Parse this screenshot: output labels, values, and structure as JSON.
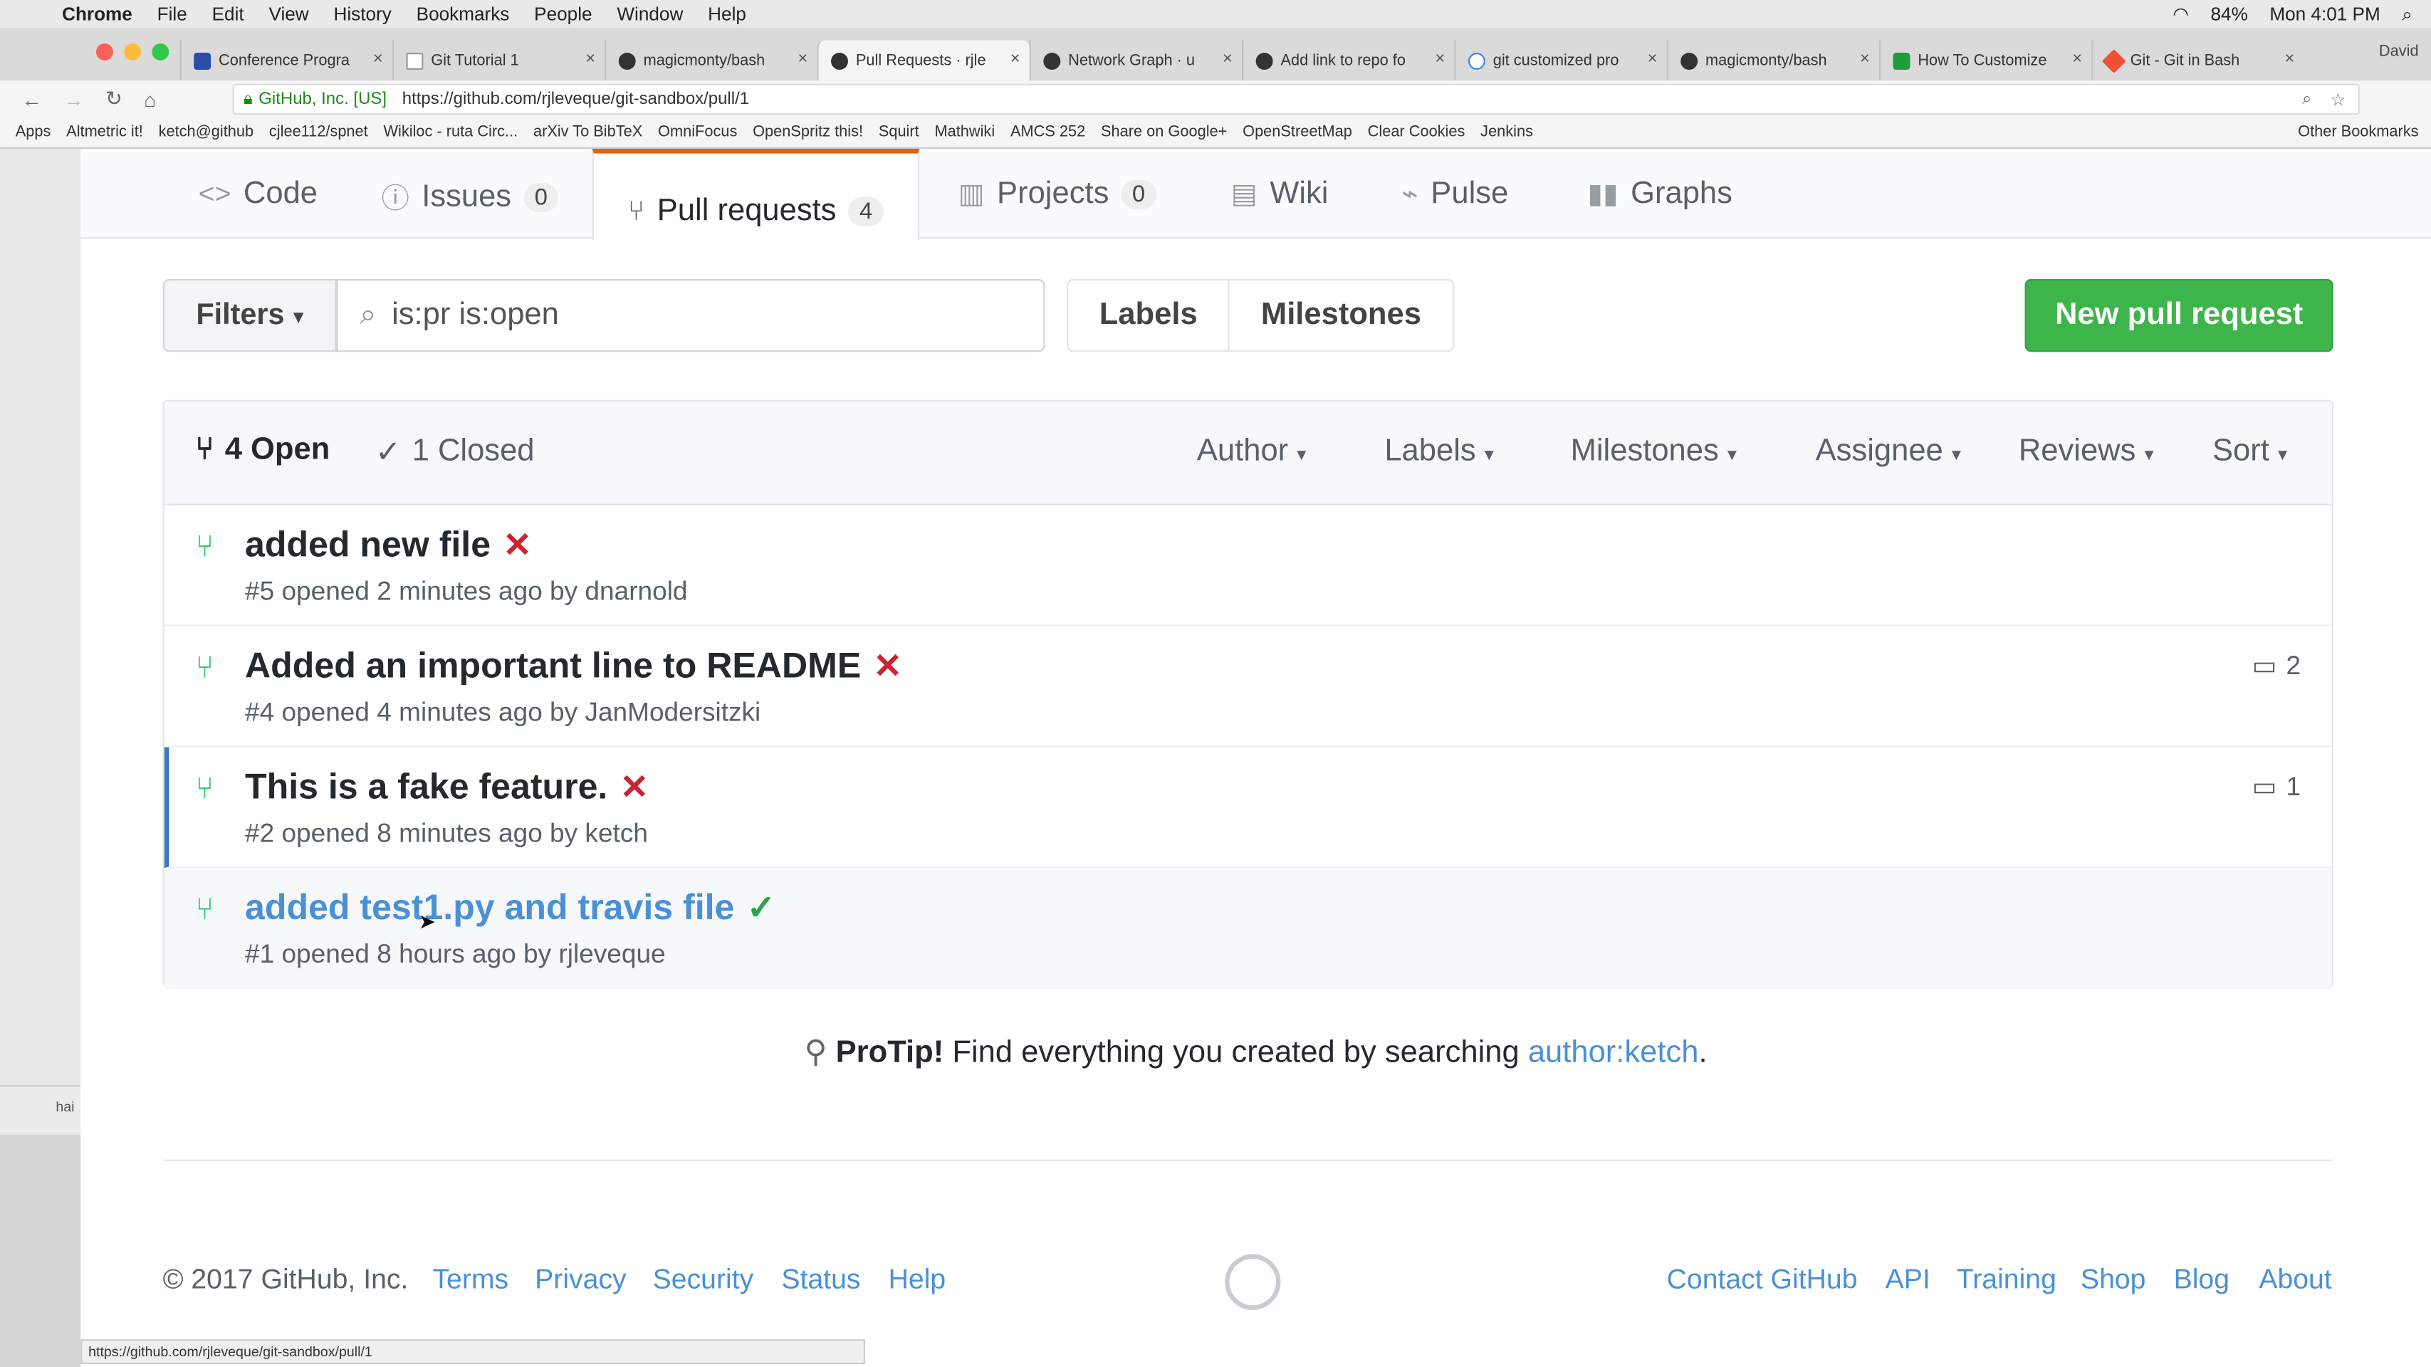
{
  "mac": {
    "apple": "",
    "app": "Chrome",
    "menus": [
      "File",
      "Edit",
      "View",
      "History",
      "Bookmarks",
      "People",
      "Window",
      "Help"
    ],
    "battery": "84%",
    "clock": "Mon 4:01 PM",
    "user": "David"
  },
  "browser": {
    "tabs": [
      {
        "title": "Conference Progra"
      },
      {
        "title": "Git Tutorial 1"
      },
      {
        "title": "magicmonty/bash"
      },
      {
        "title": "Pull Requests · rjle"
      },
      {
        "title": "Network Graph · u"
      },
      {
        "title": "Add link to repo fo"
      },
      {
        "title": "git customized pro"
      },
      {
        "title": "magicmonty/bash"
      },
      {
        "title": "How To Customize"
      },
      {
        "title": "Git - Git in Bash"
      }
    ],
    "security_label": "GitHub, Inc. [US]",
    "url": "https://github.com/rjleveque/git-sandbox/pull/1",
    "bookmarks": [
      "Apps",
      "Altmetric it!",
      "ketch@github",
      "cjlee112/spnet",
      "Wikiloc - ruta Circ...",
      "arXiv To BibTeX",
      "OmniFocus",
      "OpenSpritz this!",
      "Squirt",
      "Mathwiki",
      "AMCS 252",
      "Share on Google+",
      "OpenStreetMap",
      "Clear Cookies",
      "Jenkins"
    ],
    "other_bookmarks": "Other Bookmarks",
    "status_url": "https://github.com/rjleveque/git-sandbox/pull/1",
    "left_stub": "hai"
  },
  "repo_nav": {
    "code": "Code",
    "issues": "Issues",
    "issues_count": "0",
    "pulls": "Pull requests",
    "pulls_count": "4",
    "projects": "Projects",
    "projects_count": "0",
    "wiki": "Wiki",
    "pulse": "Pulse",
    "graphs": "Graphs"
  },
  "toolbar": {
    "filters": "Filters",
    "search_value": "is:pr is:open",
    "labels": "Labels",
    "milestones": "Milestones",
    "new_pr": "New pull request"
  },
  "list_header": {
    "open": "4 Open",
    "closed": "1 Closed",
    "author": "Author",
    "labels": "Labels",
    "milestones": "Milestones",
    "assignee": "Assignee",
    "reviews": "Reviews",
    "sort": "Sort"
  },
  "prs": [
    {
      "title": "added new file",
      "status": "✕",
      "meta": "#5 opened 2 minutes ago by dnarnold",
      "comments": ""
    },
    {
      "title": "Added an important line to README",
      "status": "✕",
      "meta": "#4 opened 4 minutes ago by JanModersitzki",
      "comments": "2"
    },
    {
      "title": "This is a fake feature.",
      "status": "✕",
      "meta": "#2 opened 8 minutes ago by ketch",
      "comments": "1"
    },
    {
      "title": "added test1.py and travis file",
      "status": "✓",
      "meta": "#1 opened 8 hours ago by rjleveque",
      "comments": ""
    }
  ],
  "protip": {
    "label": "ProTip!",
    "text": "Find everything you created by searching",
    "link": "author:ketch",
    "end": "."
  },
  "footer": {
    "copyright": "© 2017 GitHub, Inc.",
    "left_links": [
      "Terms",
      "Privacy",
      "Security",
      "Status",
      "Help"
    ],
    "right_links": [
      "Contact GitHub",
      "API",
      "Training",
      "Shop",
      "Blog",
      "About"
    ]
  }
}
